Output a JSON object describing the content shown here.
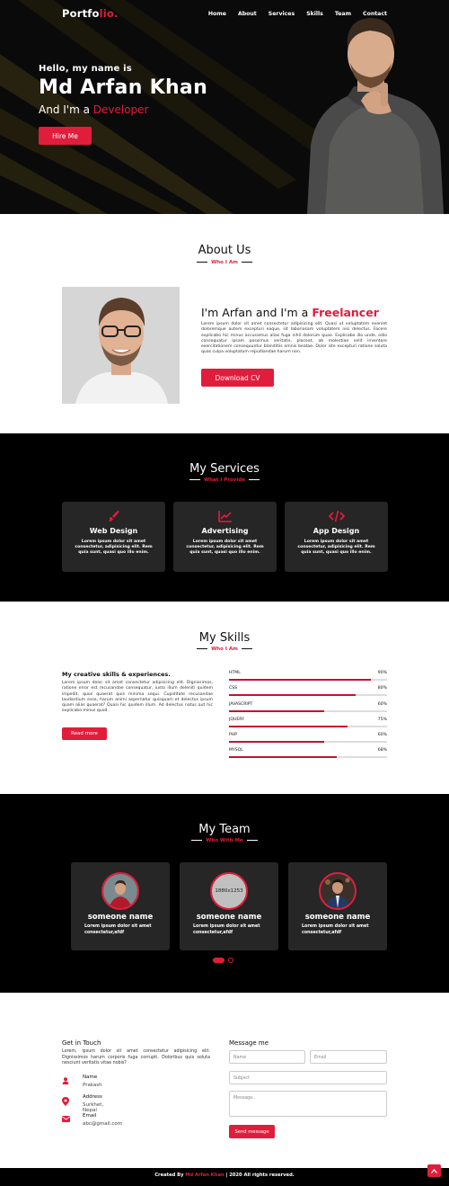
{
  "brand": {
    "name_main": "Portfo",
    "name_accent": "lio.",
    "accent_color": "#e11d3c"
  },
  "nav": [
    "Home",
    "About",
    "Services",
    "Skills",
    "Team",
    "Contact"
  ],
  "hero": {
    "greeting": "Hello, my name is",
    "name": "Md Arfan Khan",
    "role_prefix": "And I'm a ",
    "role_accent": "Developer",
    "button": "Hire Me"
  },
  "about": {
    "title": "About Us",
    "subtitle": "Who I Am",
    "heading_prefix": "I'm Arfan and I'm a ",
    "heading_accent": "Freelancer",
    "text": "Lorem ipsum dolor sit amet consectetur adipisicing elit. Quasi ut voluptatem eveniet doloremque autem excepturi eaque, sit laboriosam voluptatem nisi delectus. Facere explicabo hic minus accusamus alias fuga nihil dolorum quae. Explicabo illo unde, odio consequatur ipsam possimus veritatis, placeat, ab molestiae velit inventore exercitationem consequuntur blanditiis omnis beatae. Dolor iste excepturi ratione soluta quas culpa voluptatum repudiandae harum non.",
    "button": "Download CV"
  },
  "services": {
    "title": "My Services",
    "subtitle": "What I Provide",
    "cards": [
      {
        "icon": "paintbrush-icon",
        "title": "Web Design",
        "text": "Lorem ipsum dolor sit amet consectetur, adipisicing elit. Rem quia sunt, quasi quo illo enim."
      },
      {
        "icon": "chart-line-icon",
        "title": "Advertising",
        "text": "Lorem ipsum dolor sit amet consectetur, adipisicing elit. Rem quia sunt, quasi quo illo enim."
      },
      {
        "icon": "code-icon",
        "title": "App Design",
        "text": "Lorem ipsum dolor sit amet consectetur, adipisicing elit. Rem quia sunt, quasi quo illo enim."
      }
    ]
  },
  "skills": {
    "title": "My Skills",
    "subtitle": "Who I Am",
    "heading": "My creative skills & experiences.",
    "text": "Lorem ipsum dolor sit amet consectetur adipisicing elit. Dignissimos, ratione error est recusandae consequatur, iusto illum deleniti quidem impedit, quos quaerat quis minima sequi. Cupiditate recusandae laudantium esse, harum animi aspernatur quisquam et delectus ipsum quam alias quaerat? Quasi hic quidem illum. Ad delectus natus aut hic explicabo minus quod.",
    "button": "Read more",
    "items": [
      {
        "name": "HTML",
        "percent": "90%",
        "value": 90
      },
      {
        "name": "CSS",
        "percent": "80%",
        "value": 80
      },
      {
        "name": "JAVASCRIPT",
        "percent": "60%",
        "value": 60
      },
      {
        "name": "JQUERY",
        "percent": "75%",
        "value": 75
      },
      {
        "name": "PHP",
        "percent": "60%",
        "value": 60
      },
      {
        "name": "MYSQL",
        "percent": "68%",
        "value": 68
      }
    ]
  },
  "team": {
    "title": "My Team",
    "subtitle": "Who With Me",
    "members": [
      {
        "name": "someone name",
        "text": "Lorem ipsum dolor sit amet consectetur,afdf",
        "photo": "avatar"
      },
      {
        "name": "someone name",
        "text": "Lorem ipsum dolor sit amet consectetur,afdf",
        "photo_placeholder": "1880x1253"
      },
      {
        "name": "someone name",
        "text": "Lorem ipsum dolor sit amet consectetur,afdf",
        "photo": "avatar"
      }
    ]
  },
  "contact": {
    "title": "Get in Touch",
    "text": "Lorem, ipsum dolor sit amet consectetur adipisicing elit. Dignissimos harum corporis fuga corrupti. Doloribus quis soluta nesciunt veritatis vitae nobis?",
    "info": [
      {
        "icon": "user-icon",
        "label": "Name",
        "value": "Prakash"
      },
      {
        "icon": "map-marker-icon",
        "label": "Address",
        "value": "Surkhet, Nepal"
      },
      {
        "icon": "envelope-icon",
        "label": "Email",
        "value": "abc@gmail.com"
      }
    ],
    "form_title": "Message me",
    "placeholders": {
      "name": "Name",
      "email": "Email",
      "subject": "Subject",
      "message": "Message.."
    },
    "button": "Send message"
  },
  "footer": {
    "prefix": "Created By ",
    "author": "Md Arfan Khan",
    "suffix": " | 2020 All rights reserved."
  }
}
